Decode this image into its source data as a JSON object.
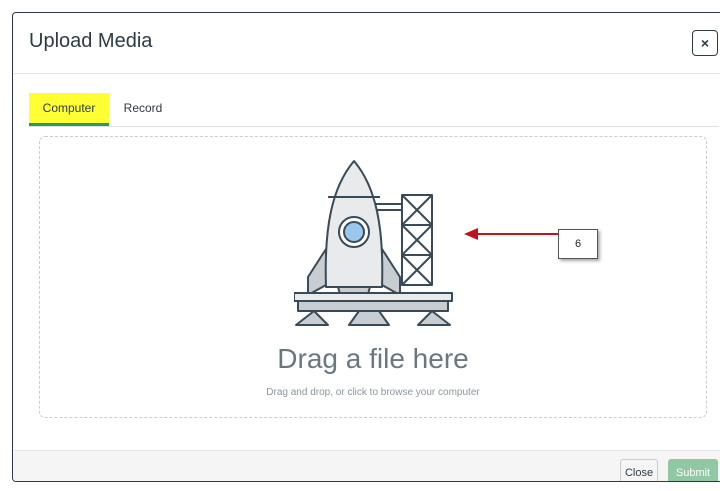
{
  "modal": {
    "title": "Upload Media",
    "close_icon_label": "×"
  },
  "tabs": [
    {
      "label": "Computer",
      "selected": true
    },
    {
      "label": "Record",
      "selected": false
    }
  ],
  "dropzone": {
    "icon": "rocket-launch-icon",
    "title": "Drag a file here",
    "subtitle": "Drag and drop, or click to browse your computer"
  },
  "annotation": {
    "callout_label": "6",
    "arrow_color": "#c0141c"
  },
  "footer": {
    "close_label": "Close",
    "submit_label": "Submit"
  },
  "colors": {
    "tab_highlight": "#ffff33",
    "tab_underline": "#2a9a52",
    "submit_bg": "#8fc8a3"
  }
}
